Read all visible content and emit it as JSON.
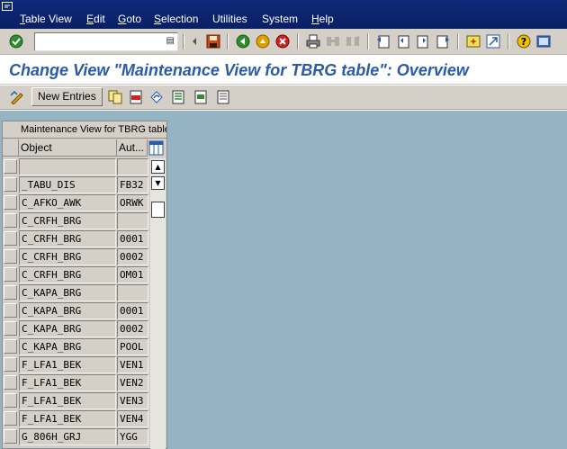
{
  "menu": {
    "items": [
      {
        "mnemonic": "T",
        "rest": "able View"
      },
      {
        "mnemonic": "E",
        "rest": "dit"
      },
      {
        "mnemonic": "G",
        "rest": "oto"
      },
      {
        "mnemonic": "S",
        "rest": "election"
      },
      {
        "mnemonic": "",
        "rest": "Utilities"
      },
      {
        "mnemonic": "",
        "rest": "System"
      },
      {
        "mnemonic": "H",
        "rest": "elp"
      }
    ]
  },
  "command_field": {
    "value": ""
  },
  "page": {
    "title": "Change View \"Maintenance View for TBRG table\": Overview"
  },
  "app_toolbar": {
    "new_entries_label": "New Entries"
  },
  "table": {
    "caption": "Maintenance View for TBRG table",
    "columns": [
      "Object",
      "Aut..."
    ],
    "rows": [
      {
        "object": "",
        "aut": ""
      },
      {
        "object": "_TABU_DIS",
        "aut": "FB32"
      },
      {
        "object": "C_AFKO_AWK",
        "aut": "ORWK"
      },
      {
        "object": "C_CRFH_BRG",
        "aut": ""
      },
      {
        "object": "C_CRFH_BRG",
        "aut": "0001"
      },
      {
        "object": "C_CRFH_BRG",
        "aut": "0002"
      },
      {
        "object": "C_CRFH_BRG",
        "aut": "OM01"
      },
      {
        "object": "C_KAPA_BRG",
        "aut": ""
      },
      {
        "object": "C_KAPA_BRG",
        "aut": "0001"
      },
      {
        "object": "C_KAPA_BRG",
        "aut": "0002"
      },
      {
        "object": "C_KAPA_BRG",
        "aut": "POOL"
      },
      {
        "object": "F_LFA1_BEK",
        "aut": "VEN1"
      },
      {
        "object": "F_LFA1_BEK",
        "aut": "VEN2"
      },
      {
        "object": "F_LFA1_BEK",
        "aut": "VEN3"
      },
      {
        "object": "F_LFA1_BEK",
        "aut": "VEN4"
      },
      {
        "object": "G_806H_GRJ",
        "aut": "YGG"
      }
    ]
  },
  "colors": {
    "menubar": "#0e2a7a",
    "title": "#2a5aa8",
    "workarea": "#94b4c4",
    "toolbar": "#d4d0c8"
  }
}
